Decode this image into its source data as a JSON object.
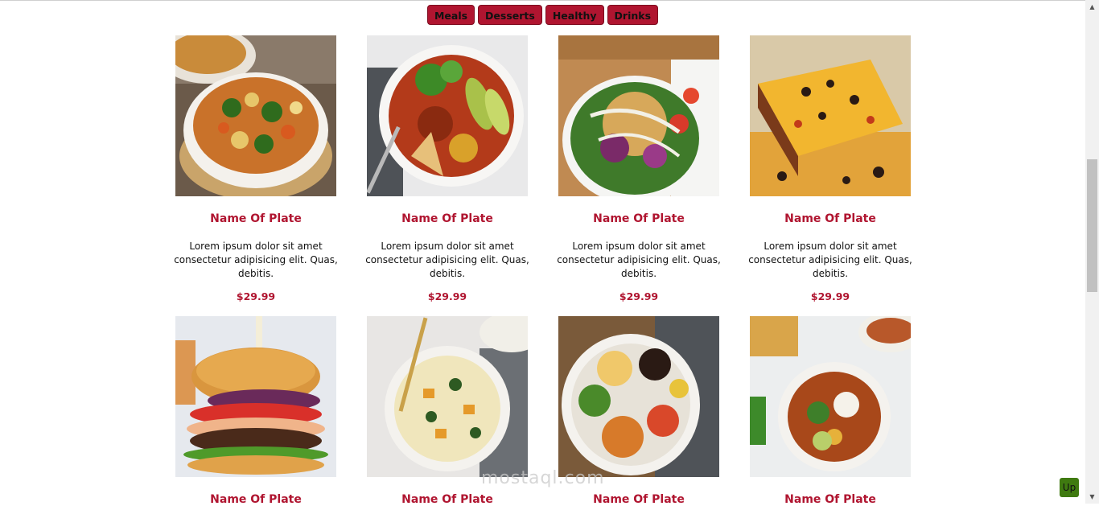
{
  "filters": [
    "Meals",
    "Desserts",
    "Healthy",
    "Drinks"
  ],
  "cards": [
    {
      "title": "Name Of Plate",
      "desc": "Lorem ipsum dolor sit amet consectetur adipisicing elit. Quas, debitis.",
      "price": "$29.99",
      "image": "vegetable-soup-bowl"
    },
    {
      "title": "Name Of Plate",
      "desc": "Lorem ipsum dolor sit amet consectetur adipisicing elit. Quas, debitis.",
      "price": "$29.99",
      "image": "tortilla-soup-avocado"
    },
    {
      "title": "Name Of Plate",
      "desc": "Lorem ipsum dolor sit amet consectetur adipisicing elit. Quas, debitis.",
      "price": "$29.99",
      "image": "chickpea-salad-bowl"
    },
    {
      "title": "Name Of Plate",
      "desc": "Lorem ipsum dolor sit amet consectetur adipisicing elit. Quas, debitis.",
      "price": "$29.99",
      "image": "mexican-casserole"
    },
    {
      "title": "Name Of Plate",
      "desc": "",
      "price": "",
      "image": "burger"
    },
    {
      "title": "Name Of Plate",
      "desc": "",
      "price": "",
      "image": "creamy-squash-soup"
    },
    {
      "title": "Name Of Plate",
      "desc": "",
      "price": "",
      "image": "chicken-burrito-bowl"
    },
    {
      "title": "Name Of Plate",
      "desc": "",
      "price": "",
      "image": "chili-bowl-cornbread"
    }
  ],
  "up_label": "Up",
  "watermark": "mostaql.com",
  "colors": {
    "accent": "#b01530",
    "up_button": "#3f7a10"
  }
}
